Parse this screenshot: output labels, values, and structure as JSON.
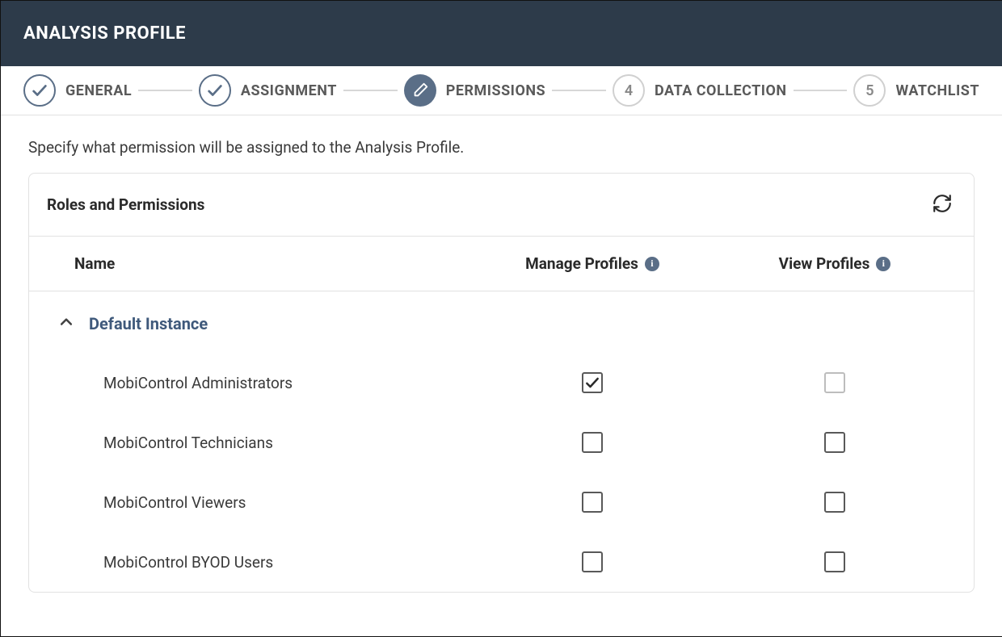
{
  "header": {
    "title": "ANALYSIS PROFILE"
  },
  "stepper": {
    "steps": [
      {
        "label": "GENERAL",
        "state": "done"
      },
      {
        "label": "ASSIGNMENT",
        "state": "done"
      },
      {
        "label": "PERMISSIONS",
        "state": "active"
      },
      {
        "label": "DATA COLLECTION",
        "state": "upcoming",
        "num": "4"
      },
      {
        "label": "WATCHLIST",
        "state": "upcoming",
        "num": "5"
      }
    ]
  },
  "intro": "Specify what permission will be assigned to the Analysis Profile.",
  "panel": {
    "title": "Roles and Permissions",
    "columns": {
      "name": "Name",
      "manage": "Manage Profiles",
      "view": "View Profiles"
    },
    "group": {
      "label": "Default Instance",
      "roles": [
        {
          "name": "MobiControl Administrators",
          "manage": true,
          "view": false,
          "viewLight": true
        },
        {
          "name": "MobiControl Technicians",
          "manage": false,
          "view": false
        },
        {
          "name": "MobiControl Viewers",
          "manage": false,
          "view": false
        },
        {
          "name": "MobiControl BYOD Users",
          "manage": false,
          "view": false
        }
      ]
    }
  }
}
